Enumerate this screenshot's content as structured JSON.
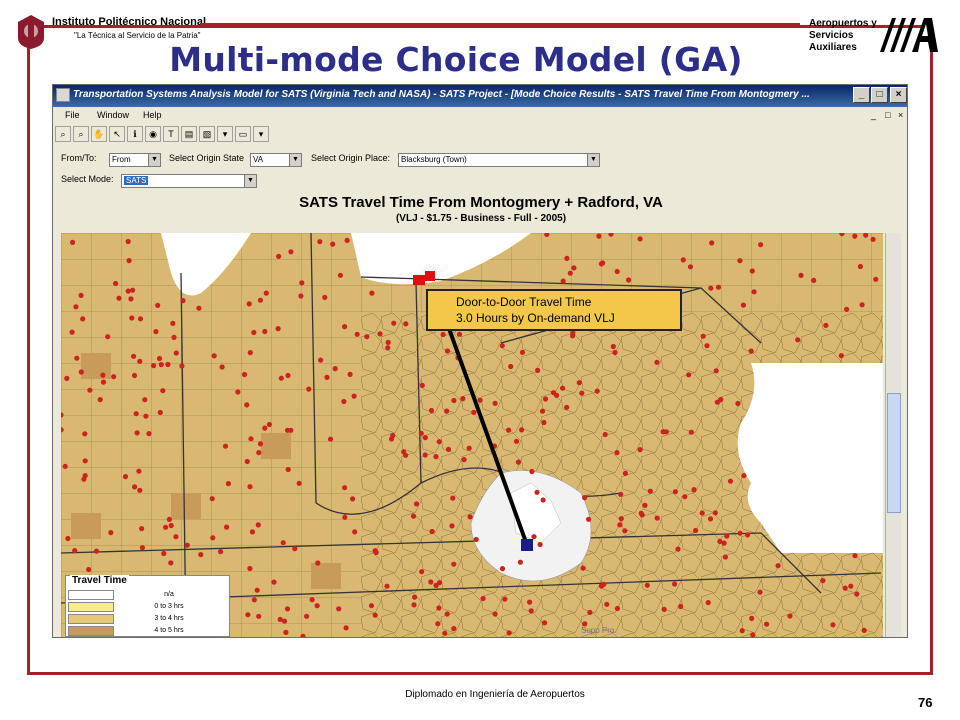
{
  "header": {
    "institution_name": "Instituto Politécnico Nacional",
    "institution_motto": "\"La Técnica al Servicio de la Patria\"",
    "right_logo_lines": [
      "Aeropuertos y",
      "Servicios",
      "Auxiliares"
    ],
    "slide_title": "Multi-mode Choice Model (GA)"
  },
  "window": {
    "title": "Transportation Systems Analysis Model for SATS (Virginia Tech and NASA) - SATS Project - [Mode Choice Results - SATS Travel Time From Montogmery ...",
    "menu": [
      "File",
      "Window",
      "Help"
    ],
    "title_buttons": [
      "_",
      "□",
      "×"
    ],
    "mdi_buttons": [
      "_",
      "□",
      "×"
    ],
    "toolbar_glyphs": [
      "⌕",
      "⌕",
      "✋",
      "↖",
      "ℹ",
      "◉",
      "T",
      "▤",
      "▧",
      "▾",
      "▭",
      "▾"
    ]
  },
  "form": {
    "from_to_label": "From/To:",
    "from_to_value": "From",
    "origin_state_label": "Select Origin State",
    "origin_state_value": "VA",
    "origin_place_label": "Select Origin Place:",
    "origin_place_value": "Blacksburg (Town)",
    "mode_label": "Select Mode:",
    "mode_value": "SATS"
  },
  "map": {
    "title": "SATS Travel Time From Montogmery + Radford, VA",
    "subtitle": "(VLJ - $1.75 - Business - Full - 2005)",
    "callout_line1": "Door-to-Door Travel Time",
    "callout_line2": "3.0 Hours by On-demand VLJ",
    "legend_title": "Travel Time",
    "legend": [
      {
        "label": "n/a",
        "color": "#ffffff"
      },
      {
        "label": "0 to 3 hrs",
        "color": "#f6ec8c"
      },
      {
        "label": "3 to 4 hrs",
        "color": "#e6c878"
      },
      {
        "label": "4 to 5 hrs",
        "color": "#c89b5a"
      }
    ],
    "credit": "Supp Pro"
  },
  "footer": {
    "course": "Diplomado en Ingeniería de Aeropuertos",
    "page": "76"
  },
  "colors": {
    "frame": "#a3222a",
    "title": "#2c2e8a",
    "county_fill": "#d9b972",
    "dot": "#cc2222",
    "callout": "#f2c84b"
  }
}
